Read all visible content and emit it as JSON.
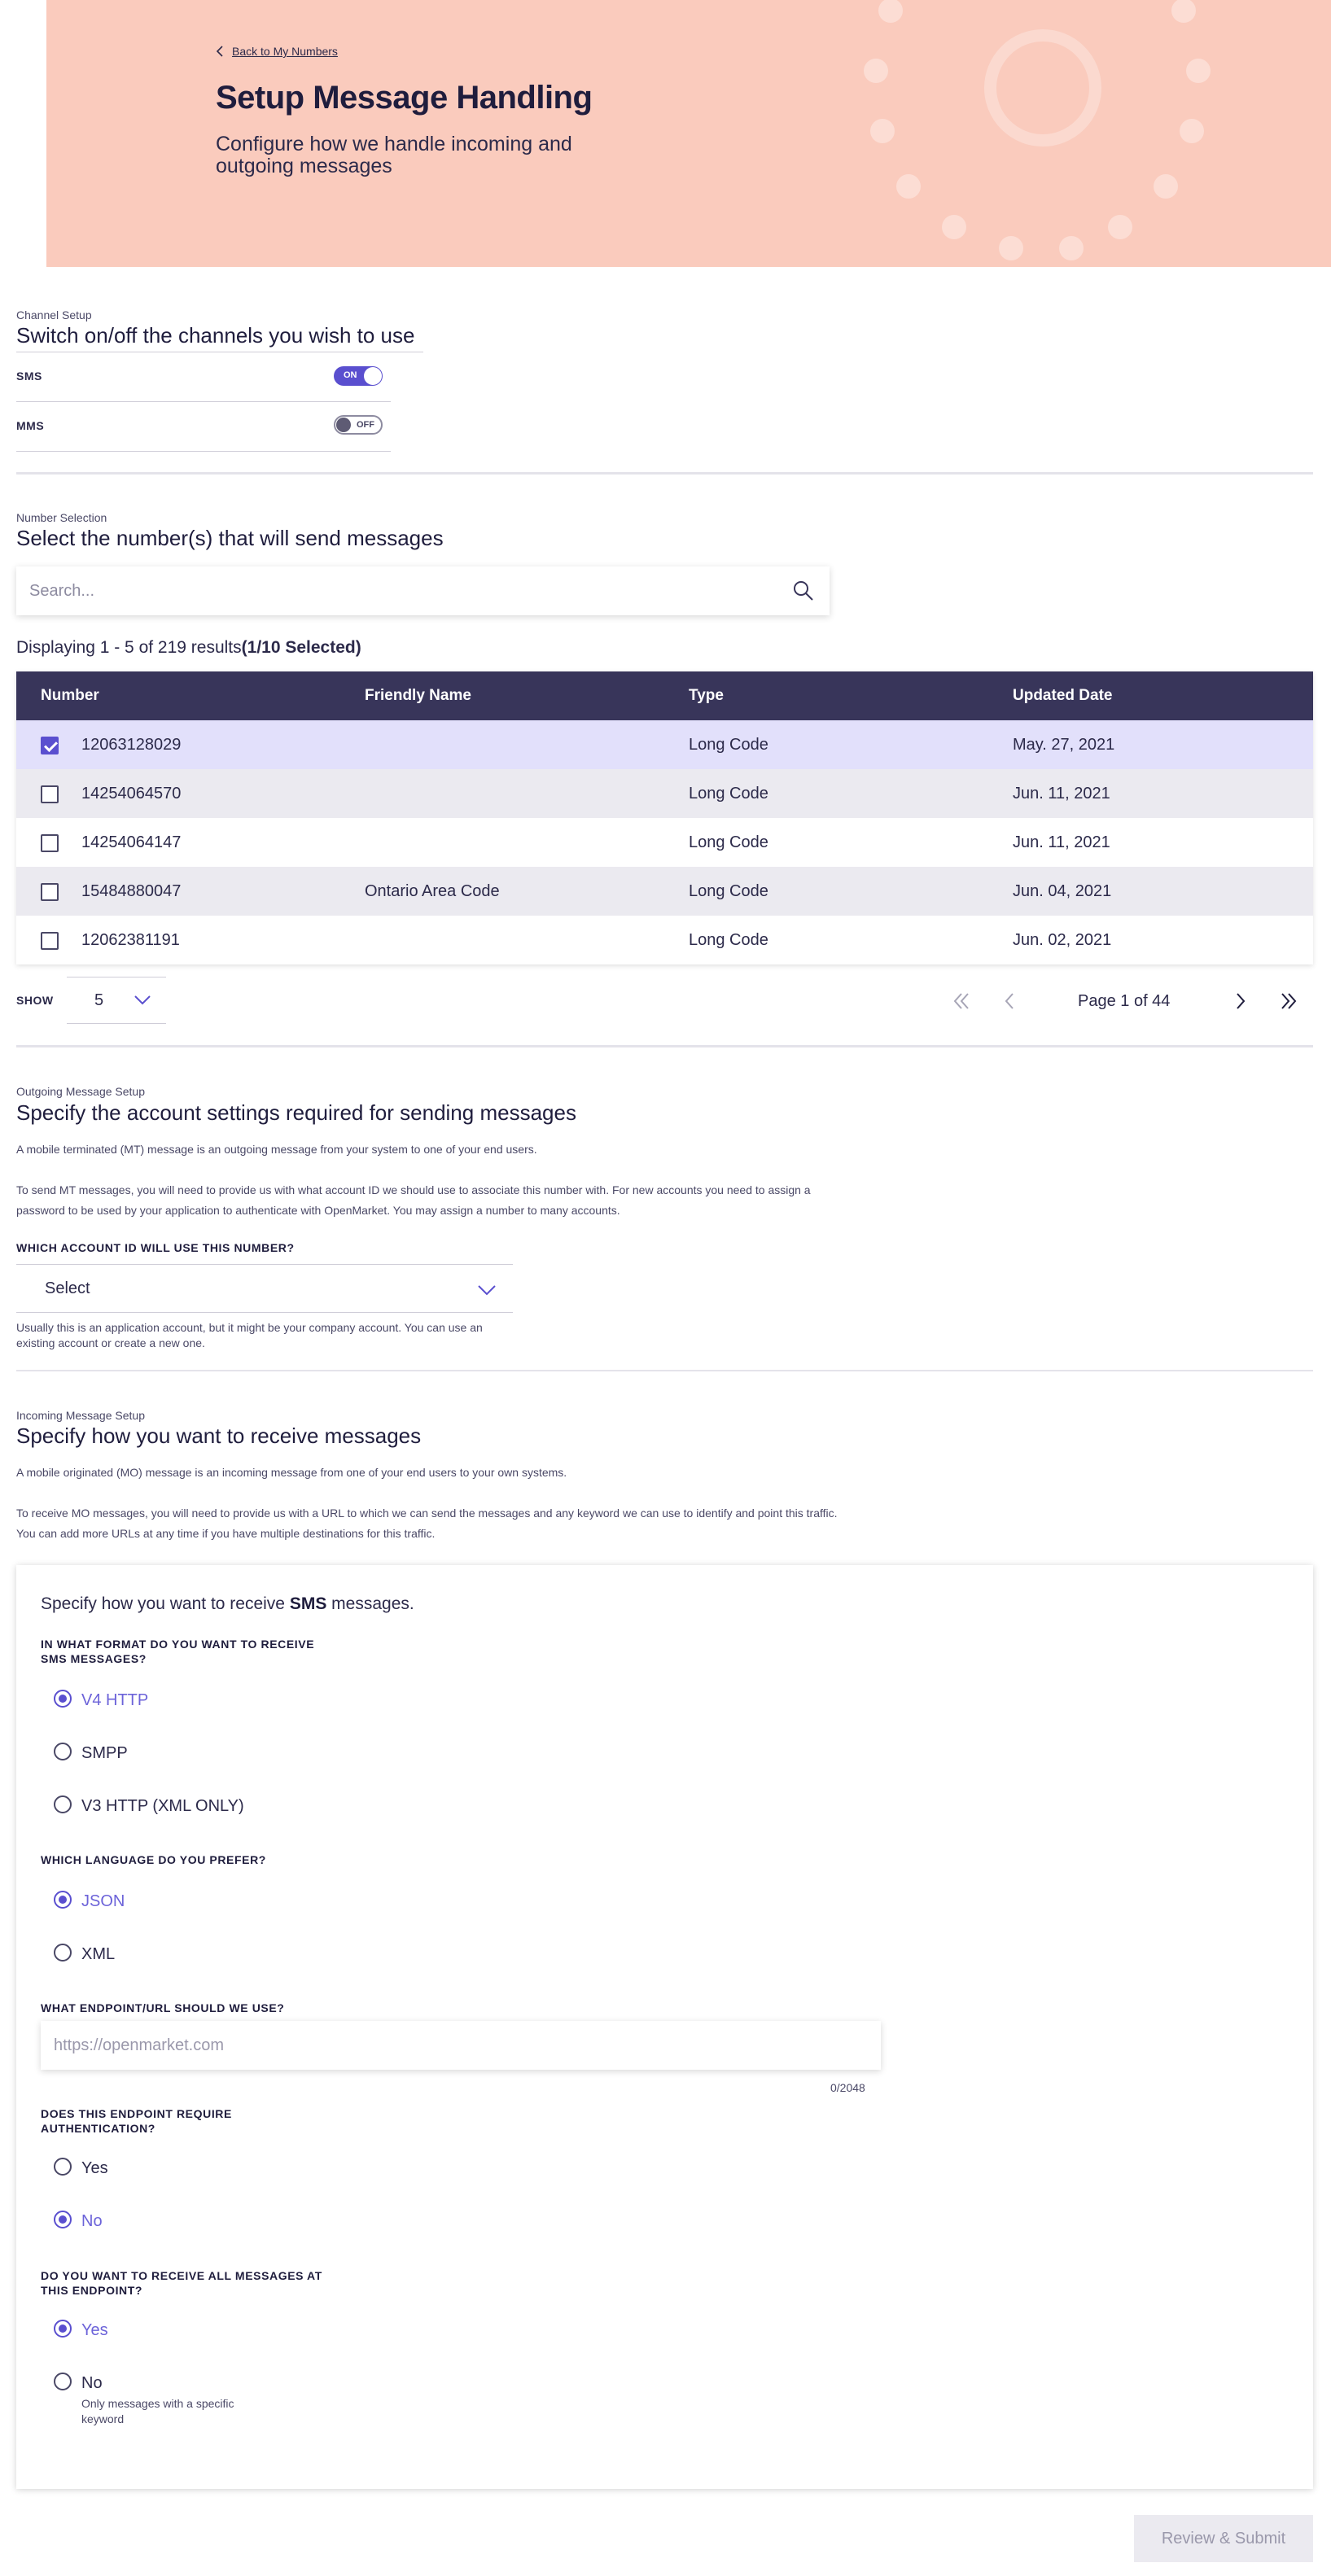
{
  "hero": {
    "back_link": "Back to My Numbers",
    "title": "Setup Message Handling",
    "subtitle": "Configure how we handle incoming and outgoing messages"
  },
  "channel_setup": {
    "kicker": "Channel Setup",
    "title": "Switch on/off the channels you wish to use",
    "channels": [
      {
        "label": "SMS",
        "state": "ON"
      },
      {
        "label": "MMS",
        "state": "OFF"
      }
    ]
  },
  "number_selection": {
    "kicker": "Number Selection",
    "title": "Select the number(s) that will send messages",
    "search_placeholder": "Search...",
    "results_text": "Displaying 1 - 5 of 219 results",
    "selected_text": "(1/10 Selected)",
    "columns": [
      "Number",
      "Friendly Name",
      "Type",
      "Updated Date"
    ],
    "rows": [
      {
        "number": "12063128029",
        "friendly": "",
        "type": "Long Code",
        "date": "May. 27, 2021",
        "checked": true
      },
      {
        "number": "14254064570",
        "friendly": "",
        "type": "Long Code",
        "date": "Jun. 11, 2021",
        "checked": false
      },
      {
        "number": "14254064147",
        "friendly": "",
        "type": "Long Code",
        "date": "Jun. 11, 2021",
        "checked": false
      },
      {
        "number": "15484880047",
        "friendly": "Ontario Area Code",
        "type": "Long Code",
        "date": "Jun. 04, 2021",
        "checked": false
      },
      {
        "number": "12062381191",
        "friendly": "",
        "type": "Long Code",
        "date": "Jun. 02, 2021",
        "checked": false
      }
    ],
    "show_label": "SHOW",
    "show_value": "5",
    "page_text": "Page 1 of 44"
  },
  "outgoing": {
    "kicker": "Outgoing Message Setup",
    "title": "Specify the account settings required for sending messages",
    "para1": "A mobile terminated (MT) message is an outgoing message from your system to one of your end users.",
    "para2": "To send MT messages, you will need to provide us with what account ID we should use to associate this number with. For new accounts you need to assign a password to be used by your application to authenticate with OpenMarket. You may assign a number to many accounts.",
    "account_label": "WHICH ACCOUNT ID WILL USE THIS NUMBER?",
    "account_value": "Select",
    "helper": "Usually this is an application account, but it might be your company account. You can use an existing account or create a new one."
  },
  "incoming": {
    "kicker": "Incoming Message Setup",
    "title": "Specify how you want to receive messages",
    "para1": "A mobile originated (MO) message is an incoming message from one of your end users to your own systems.",
    "para2": "To receive MO messages, you will need to provide us with a URL to which we can send the messages and any keyword we can use to identify and point this traffic. You can add more URLs at any time if you have multiple destinations for this traffic.",
    "intro_pre": "Specify how you want to receive ",
    "intro_bold": "SMS",
    "intro_post": " messages.",
    "format_q": "IN WHAT FORMAT DO YOU WANT TO RECEIVE SMS MESSAGES?",
    "format_options": [
      "V4 HTTP",
      "SMPP",
      "V3 HTTP (XML ONLY)"
    ],
    "language_q": "WHICH LANGUAGE DO YOU PREFER?",
    "language_options": [
      "JSON",
      "XML"
    ],
    "endpoint_q": "WHAT ENDPOINT/URL SHOULD WE USE?",
    "endpoint_placeholder": "https://openmarket.com",
    "endpoint_counter": "0/2048",
    "auth_q": "DOES THIS ENDPOINT REQUIRE AUTHENTICATION?",
    "auth_options": [
      "Yes",
      "No"
    ],
    "all_q": "DO YOU WANT TO RECEIVE ALL MESSAGES AT THIS ENDPOINT?",
    "all_options": [
      "Yes",
      "No"
    ],
    "all_no_sub": "Only messages with a specific keyword"
  },
  "submit_label": "Review & Submit",
  "colors": {
    "hero_bg": "#facbbd",
    "accent": "#5a4fcf",
    "table_header": "#38355a",
    "selected_row": "#e2e0fb"
  }
}
